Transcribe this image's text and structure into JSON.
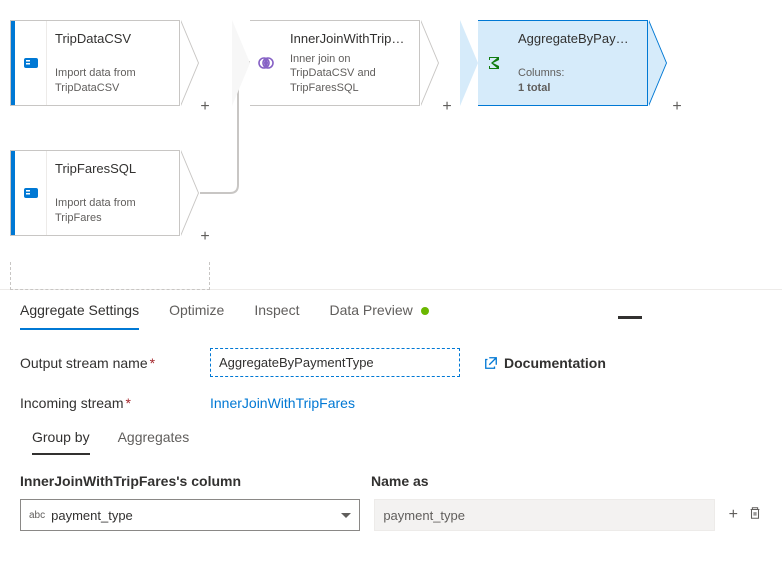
{
  "canvas": {
    "nodes": [
      {
        "title": "TripDataCSV",
        "sub": "Import data from TripDataCSV"
      },
      {
        "title": "TripFaresSQL",
        "sub": "Import data from TripFares"
      },
      {
        "title": "InnerJoinWithTripFares",
        "sub": "Inner join on TripDataCSV and TripFaresSQL"
      },
      {
        "title": "AggregateByPaymentTy...",
        "sub_label": "Columns:",
        "sub_value": "1 total"
      }
    ]
  },
  "tabs": {
    "aggregate": "Aggregate Settings",
    "optimize": "Optimize",
    "inspect": "Inspect",
    "preview": "Data Preview"
  },
  "form": {
    "output_label": "Output stream name",
    "output_value": "AggregateByPaymentType",
    "incoming_label": "Incoming stream",
    "incoming_value": "InnerJoinWithTripFares",
    "doc_label": "Documentation"
  },
  "subtabs": {
    "groupby": "Group by",
    "aggregates": "Aggregates"
  },
  "group": {
    "col_header": "InnerJoinWithTripFares's column",
    "name_header": "Name as",
    "column_value": "payment_type",
    "name_value": "payment_type"
  }
}
